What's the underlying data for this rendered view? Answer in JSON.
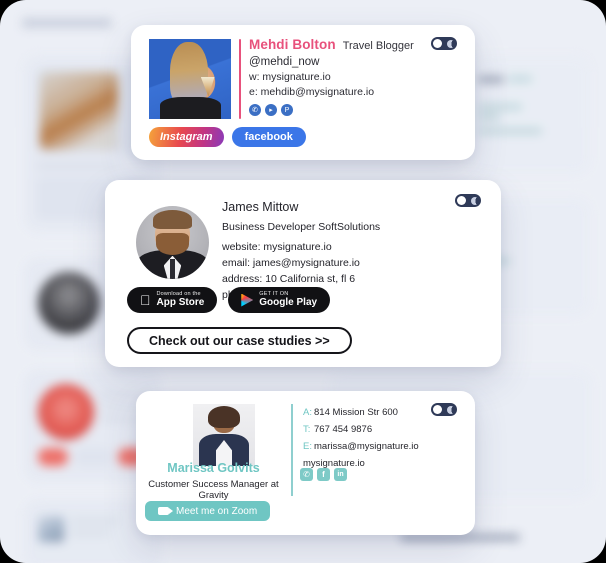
{
  "page": {
    "background_color": "#eceff6",
    "bg_title_placeholder": ""
  },
  "card1": {
    "name": "Mehdi Bolton",
    "role": "Travel Blogger",
    "handle": "@mehdi_now",
    "website_line": "w:  mysignature.io",
    "email_line": "e:  mehdib@mysignature.io",
    "name_color": "#e8517c",
    "socials": [
      {
        "name": "twitter-icon",
        "glyph": "✆"
      },
      {
        "name": "youtube-icon",
        "glyph": "▸"
      },
      {
        "name": "pinterest-icon",
        "glyph": "P"
      }
    ],
    "buttons": [
      {
        "name": "instagram-button",
        "label": "Instagram"
      },
      {
        "name": "facebook-button",
        "label": "facebook"
      }
    ],
    "toggle": {
      "name": "dark-mode-toggle",
      "state": "on"
    }
  },
  "card2": {
    "name": "James Mittow",
    "role": "Business Developer SoftSolutions",
    "website_line": "website: mysignature.io",
    "email_line": "email: james@mysignature.io",
    "address_line": "address: 10 California st, fl 6",
    "phone_line": "phone: 733 663 33",
    "app_store": {
      "sub": "Download on the",
      "main": "App Store"
    },
    "google_play": {
      "sub": "GET IT ON",
      "main": "Google Play"
    },
    "cta_label": "Check out our case studies >>",
    "toggle": {
      "name": "dark-mode-toggle",
      "state": "on"
    }
  },
  "card3": {
    "name": "Marissa Golvits",
    "role": "Customer Success Manager  at Gravity",
    "name_color": "#6fc6c3",
    "contact": [
      {
        "key": "A:",
        "value": "814 Mission Str 600"
      },
      {
        "key": "T:",
        "value": "767 454 9876"
      },
      {
        "key": "E:",
        "value": "marissa@mysignature.io"
      }
    ],
    "website": "mysignature.io",
    "socials": [
      {
        "name": "twitter-icon",
        "glyph": "✆"
      },
      {
        "name": "facebook-icon",
        "glyph": "f"
      },
      {
        "name": "linkedin-icon",
        "glyph": "in"
      }
    ],
    "zoom_button_label": "Meet me on Zoom",
    "toggle": {
      "name": "dark-mode-toggle",
      "state": "on"
    }
  }
}
